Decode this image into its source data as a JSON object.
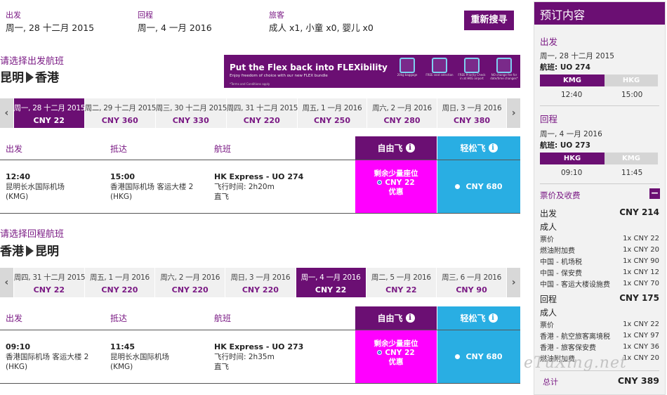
{
  "search": {
    "depart_label": "出发",
    "depart_value": "周一, 28 十二月 2015",
    "return_label": "回程",
    "return_value": "周一, 4 一月 2016",
    "pax_label": "旅客",
    "pax_value": "成人 x1, 小童 x0, 婴儿 x0",
    "button": "重新搜寻"
  },
  "banner": {
    "title": "Put the Flex back into FLEXibility",
    "subtitle": "Enjoy freedom of choice with our new FLEX bundle",
    "terms": "*Terms and Conditions apply",
    "icons": [
      {
        "icon": "baggage-icon",
        "caption": "20kg baggage"
      },
      {
        "icon": "seat-icon",
        "caption": "FREE seat selection"
      },
      {
        "icon": "checkin-icon",
        "caption": "FREE Priority Check in at HKG airport"
      },
      {
        "icon": "refund-icon",
        "caption": "NO change fee for date/time changes*"
      }
    ]
  },
  "outbound": {
    "prompt": "请选择出发航班",
    "from": "昆明",
    "to": "香港",
    "dates": [
      {
        "d": "周一, 28 十二月 2015",
        "p": "CNY 22",
        "selected": true
      },
      {
        "d": "周二, 29 十二月 2015",
        "p": "CNY 360"
      },
      {
        "d": "周三, 30 十二月 2015",
        "p": "CNY 330"
      },
      {
        "d": "周四, 31 十二月 2015",
        "p": "CNY 220"
      },
      {
        "d": "周五, 1 一月 2016",
        "p": "CNY 250"
      },
      {
        "d": "周六, 2 一月 2016",
        "p": "CNY 280"
      },
      {
        "d": "周日, 3 一月 2016",
        "p": "CNY 380"
      }
    ],
    "headers": {
      "dep": "出发",
      "arr": "抵达",
      "flight": "航班",
      "flex": "自由飞",
      "easy": "轻松飞"
    },
    "flight": {
      "dep_time": "12:40",
      "dep_airport": "昆明长水国际机场",
      "dep_code": "(KMG)",
      "arr_time": "15:00",
      "arr_airport": "香港国际机场 客运大楼 2",
      "arr_code": "(HKG)",
      "number": "HK Express - UO 274",
      "duration": "飞行时间: 2h20m",
      "stops": "直飞",
      "flex_note": "剩余少量座位",
      "flex_price": "CNY 22",
      "flex_tag": "优惠",
      "easy_price": "CNY 680"
    }
  },
  "inbound": {
    "prompt": "请选择回程航班",
    "from": "香港",
    "to": "昆明",
    "dates": [
      {
        "d": "周四, 31 十二月 2015",
        "p": "CNY 22"
      },
      {
        "d": "周五, 1 一月 2016",
        "p": "CNY 220"
      },
      {
        "d": "周六, 2 一月 2016",
        "p": "CNY 220"
      },
      {
        "d": "周日, 3 一月 2016",
        "p": "CNY 220"
      },
      {
        "d": "周一, 4 一月 2016",
        "p": "CNY 22",
        "selected": true
      },
      {
        "d": "周二, 5 一月 2016",
        "p": "CNY 22"
      },
      {
        "d": "周三, 6 一月 2016",
        "p": "CNY 90"
      }
    ],
    "headers": {
      "dep": "出发",
      "arr": "抵达",
      "flight": "航班",
      "flex": "自由飞",
      "easy": "轻松飞"
    },
    "flight": {
      "dep_time": "09:10",
      "dep_airport": "香港国际机场 客运大楼 2",
      "dep_code": "(HKG)",
      "arr_time": "11:45",
      "arr_airport": "昆明长水国际机场",
      "arr_code": "(KMG)",
      "number": "HK Express - UO 273",
      "duration": "飞行时间: 2h35m",
      "stops": "直飞",
      "flex_note": "剩余少量座位",
      "flex_price": "CNY 22",
      "flex_tag": "优惠",
      "easy_price": "CNY 680"
    }
  },
  "sidebar": {
    "title": "预订内容",
    "depart": {
      "label": "出发",
      "date": "周一, 28 十二月 2015",
      "flight": "航班: UO 274",
      "from": "KMG",
      "to": "HKG",
      "from_time": "12:40",
      "to_time": "15:00"
    },
    "return": {
      "label": "回程",
      "date": "周一, 4 一月 2016",
      "flight": "航班: UO 273",
      "from": "HKG",
      "to": "KMG",
      "from_time": "09:10",
      "to_time": "11:45"
    },
    "fees_title": "票价及收费",
    "dep_total_label": "出发",
    "dep_total": "CNY 214",
    "dep_adult": "成人",
    "dep_fees": [
      {
        "n": "票价",
        "v": "1x CNY 22"
      },
      {
        "n": "燃油附加费",
        "v": "1x CNY 20"
      },
      {
        "n": "中国 - 机场税",
        "v": "1x CNY 90"
      },
      {
        "n": "中国 - 保安费",
        "v": "1x CNY 12"
      },
      {
        "n": "中国 - 客运大楼设施费",
        "v": "1x CNY 70"
      }
    ],
    "ret_total_label": "回程",
    "ret_total": "CNY 175",
    "ret_adult": "成人",
    "ret_fees": [
      {
        "n": "票价",
        "v": "1x CNY 22"
      },
      {
        "n": "香港 - 航空旅客离境税",
        "v": "1x CNY 97"
      },
      {
        "n": "香港 - 旅客保安费",
        "v": "1x CNY 36"
      },
      {
        "n": "燃油附加费",
        "v": "1x CNY 20"
      }
    ],
    "total_label": "总计",
    "total": "CNY 389"
  },
  "watermark": "eTuXing.net"
}
